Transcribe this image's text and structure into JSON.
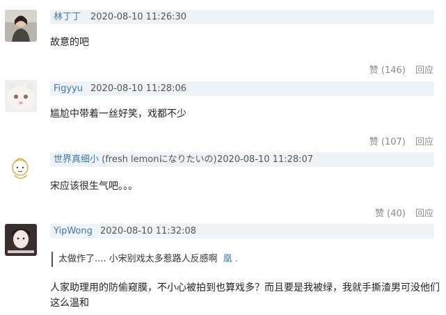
{
  "comments": [
    {
      "user": "林丁丁",
      "user_tail": "",
      "time": "2020-08-10 11:26:30",
      "text": "故意的吧",
      "like": "赞 (146)",
      "reply": "回应"
    },
    {
      "user": "Figyyu",
      "user_tail": "",
      "time": "2020-08-10 11:28:06",
      "text": "尴尬中带着一丝好笑，戏都不少",
      "like": "赞 (107)",
      "reply": "回应"
    },
    {
      "user": "世界真细小",
      "user_tail": " (fresh lemonになりたいの)",
      "time": "2020-08-10 11:28:07",
      "text": "宋应该很生气吧。。。",
      "like": "赞 (40)",
      "reply": "回应"
    },
    {
      "user": "YipWong",
      "user_tail": "",
      "time": "2020-08-10 11:32:08",
      "quote": "太做作了.... 小宋别戏太多惹路人反感啊",
      "quote_user": "凰 .",
      "text_line1": "人家助理用的防偷窥膜，不小心被拍到也算戏多？而且要是我被绿，我就手撕渣男可没他们",
      "text_line2": "这么温和"
    }
  ]
}
